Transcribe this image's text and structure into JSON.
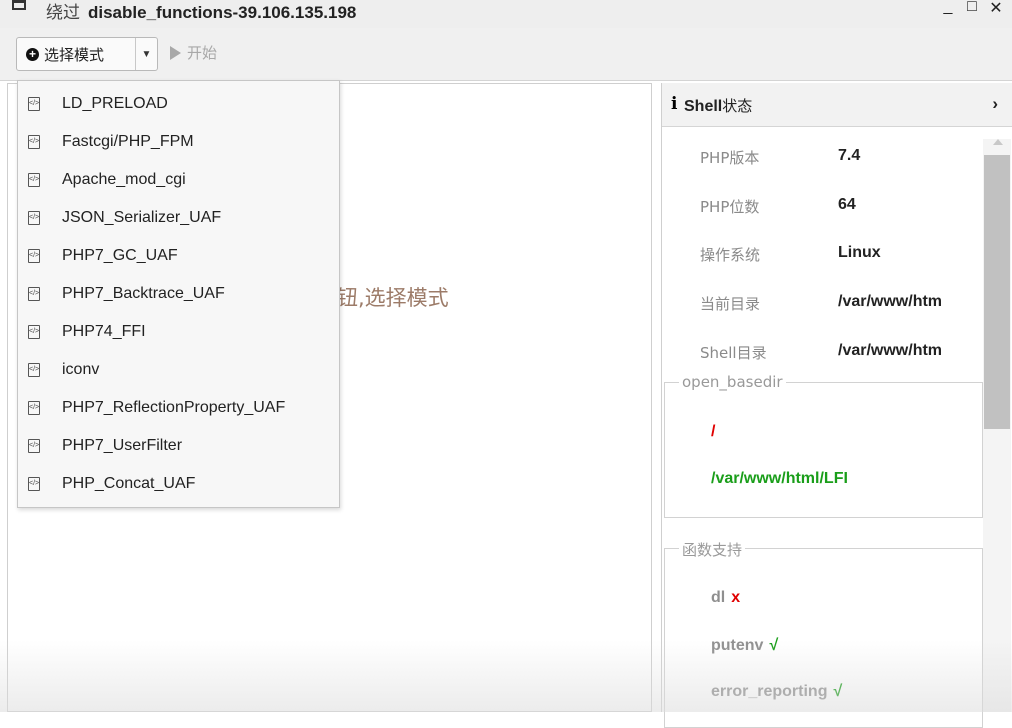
{
  "window": {
    "title_prefix": "绕过",
    "title": "disable_functions-39.106.135.198",
    "controls": [
      "_",
      "□",
      "✕"
    ]
  },
  "toolbar": {
    "mode_label": "选择模式",
    "mode_icon": "plus-circle-icon",
    "start_label": "开始",
    "start_enabled": false
  },
  "main": {
    "hint_text": "钮,选择模式",
    "dropdown_items": [
      {
        "label": "LD_PRELOAD"
      },
      {
        "label": "Fastcgi/PHP_FPM"
      },
      {
        "label": "Apache_mod_cgi"
      },
      {
        "label": "JSON_Serializer_UAF"
      },
      {
        "label": "PHP7_GC_UAF"
      },
      {
        "label": "PHP7_Backtrace_UAF"
      },
      {
        "label": "PHP74_FFI"
      },
      {
        "label": "iconv"
      },
      {
        "label": "PHP7_ReflectionProperty_UAF"
      },
      {
        "label": "PHP7_UserFilter"
      },
      {
        "label": "PHP_Concat_UAF"
      }
    ]
  },
  "shell_status": {
    "header_icon": "i",
    "title_en": "Shell",
    "title_cn": "状态",
    "rows": [
      {
        "key": "PHP版本",
        "value": "7.4"
      },
      {
        "key": "PHP位数",
        "value": "64"
      },
      {
        "key": "操作系统",
        "value": "Linux"
      },
      {
        "key": "当前目录",
        "value": "/var/www/htm"
      },
      {
        "key": "Shell目录",
        "value": "/var/www/htm"
      }
    ],
    "open_basedir": {
      "legend": "open_basedir",
      "items": [
        {
          "path": "/",
          "color": "#e00000"
        },
        {
          "path": "/var/www/html/LFI",
          "color": "#1a9e1a"
        }
      ]
    },
    "functions": {
      "legend": "函数支持",
      "items": [
        {
          "name": "dl",
          "mark": "x"
        },
        {
          "name": "putenv",
          "mark": "√"
        },
        {
          "name": "error_reporting",
          "mark": "√"
        }
      ]
    }
  },
  "colors": {
    "supported": "#1a9e1a",
    "unsupported": "#e00000"
  }
}
